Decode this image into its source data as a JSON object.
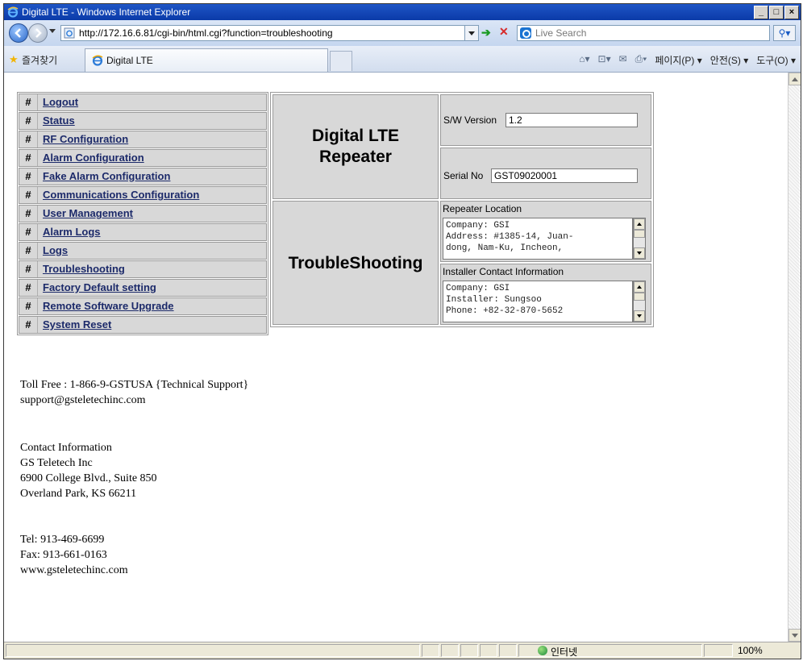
{
  "window": {
    "title": "Digital LTE - Windows Internet Explorer",
    "controls": [
      "_",
      "□",
      "×"
    ]
  },
  "addressbar": {
    "url": "http://172.16.6.81/cgi-bin/html.cgi?function=troubleshooting",
    "search_placeholder": "Live Search"
  },
  "favbar": {
    "favorites_label": "즐겨찾기",
    "tab_title": "Digital LTE",
    "commands": [
      "페이지(P) ▾",
      "안전(S) ▾",
      "도구(O) ▾"
    ]
  },
  "menu": {
    "items": [
      {
        "hash": "#",
        "label": "Logout"
      },
      {
        "hash": "#",
        "label": "Status"
      },
      {
        "hash": "#",
        "label": "RF Configuration"
      },
      {
        "hash": "#",
        "label": "Alarm Configuration"
      },
      {
        "hash": "#",
        "label": "Fake Alarm Configuration"
      },
      {
        "hash": "#",
        "label": "Communications Configuration"
      },
      {
        "hash": "#",
        "label": "User Management"
      },
      {
        "hash": "#",
        "label": "Alarm Logs"
      },
      {
        "hash": "#",
        "label": "Logs"
      },
      {
        "hash": "#",
        "label": "Troubleshooting"
      },
      {
        "hash": "#",
        "label": "Factory Default setting"
      },
      {
        "hash": "#",
        "label": "Remote Software Upgrade"
      },
      {
        "hash": "#",
        "label": "System Reset"
      }
    ]
  },
  "panel": {
    "title_line1": "Digital LTE",
    "title_line2": "Repeater",
    "sw_label": "S/W Version",
    "sw_value": "1.2",
    "serial_label": "Serial No",
    "serial_value": "GST09020001",
    "section_title": "TroubleShooting",
    "location_label": "Repeater Location",
    "location_lines": [
      "Company: GSI",
      "Address: #1385-14, Juan-",
      "dong, Nam-Ku, Incheon,"
    ],
    "installer_label": "Installer Contact Information",
    "installer_lines": [
      "Company: GSI",
      "Installer: Sungsoo",
      "Phone: +82-32-870-5652"
    ]
  },
  "footer": {
    "tollfree": "Toll Free : 1-866-9-GSTUSA {Technical Support}",
    "support_email": "support@gsteletechinc.com",
    "contact_heading": "Contact Information",
    "company": "GS Teletech Inc",
    "address1": "6900 College Blvd., Suite 850",
    "address2": "Overland Park, KS 66211",
    "tel": "Tel: 913-469-6699",
    "fax": "Fax: 913-661-0163",
    "website": "www.gsteletechinc.com"
  },
  "statusbar": {
    "zone": "인터넷",
    "zoom": "100%"
  }
}
